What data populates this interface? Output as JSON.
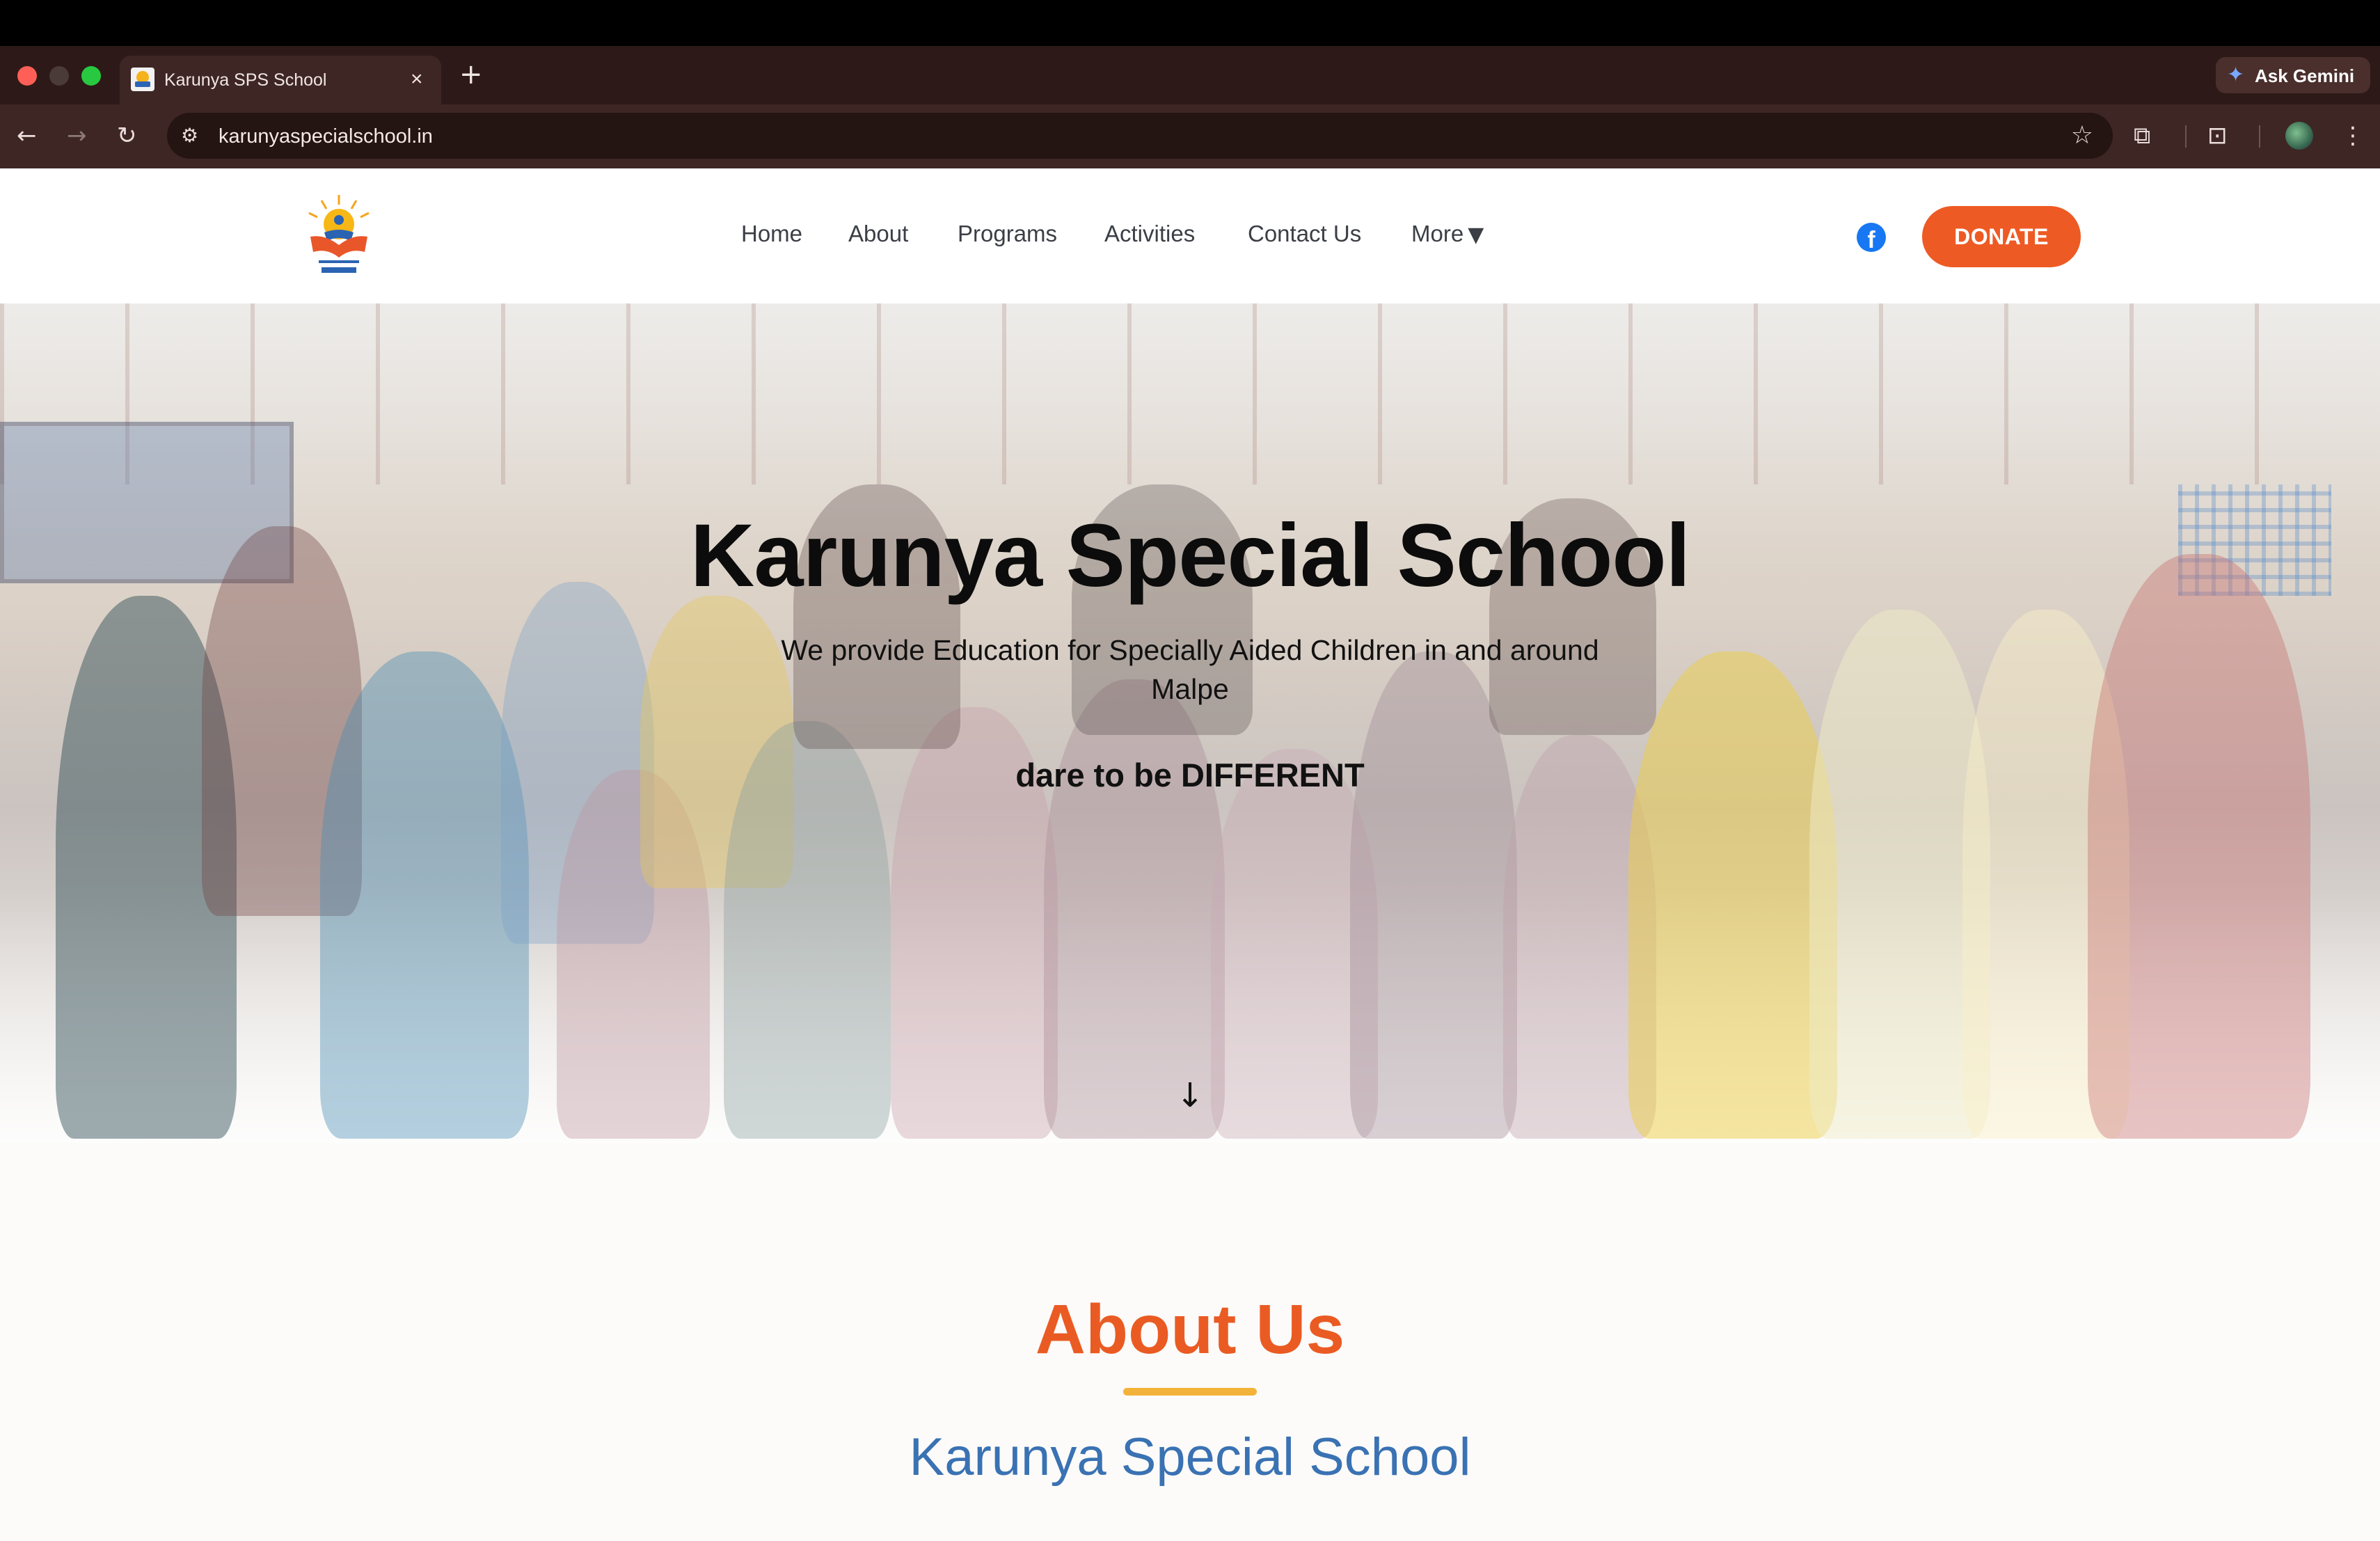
{
  "browser": {
    "tab_title": "Karunya SPS School",
    "tab_close_glyph": "×",
    "new_tab_glyph": "+",
    "url": "karunyaspecialschool.in",
    "gemini_label": "Ask Gemini"
  },
  "site": {
    "logo_icon": "karunya-sun-logo",
    "nav": {
      "home": "Home",
      "about": "About",
      "programs": "Programs",
      "activities": "Activities",
      "contact": "Contact Us",
      "more": "More"
    },
    "social_icon": "facebook-icon",
    "donate_label": "DONATE",
    "accent_color": "#ee5a24"
  },
  "hero": {
    "title": "Karunya Special School",
    "subtitle": "We provide Education for Specially Aided Children in and around Malpe",
    "tagline": "dare to be DIFFERENT",
    "scroll_icon": "arrow-down-icon"
  },
  "about": {
    "heading": "About Us",
    "subheading": "Karunya Special School",
    "heading_color": "#ea5b23",
    "subheading_color": "#3a72b3",
    "underline_color": "#f3b23a"
  }
}
